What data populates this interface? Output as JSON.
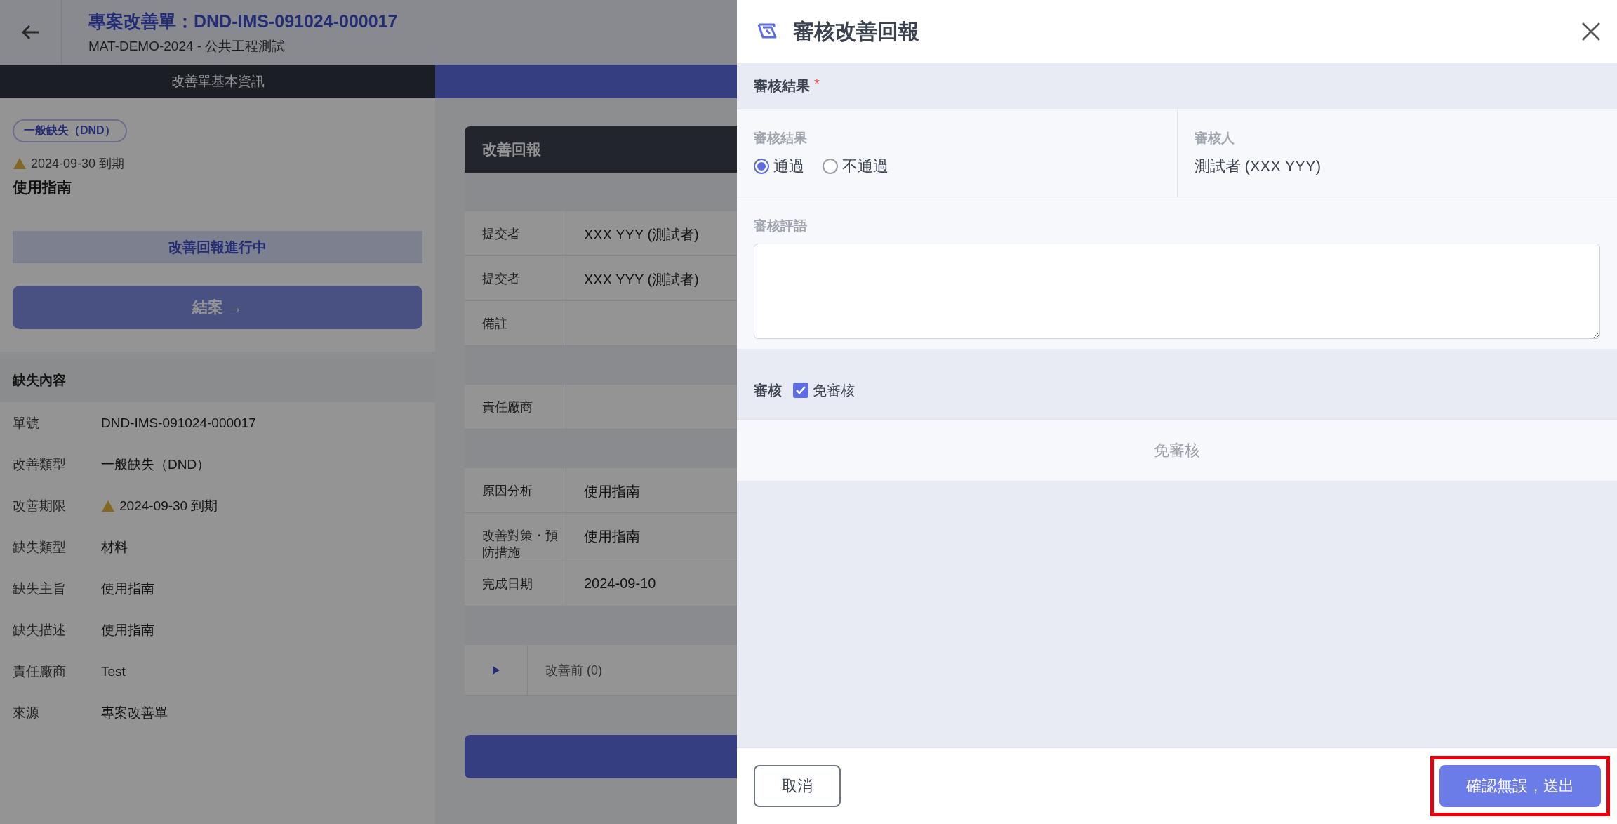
{
  "background": {
    "header": {
      "title": "專案改善單：DND-IMS-091024-000017",
      "subtitle": "MAT-DEMO-2024 - 公共工程測試"
    },
    "tabs": [
      {
        "label": "改善單基本資訊",
        "selected": true
      },
      {
        "selected": false
      }
    ],
    "summary": {
      "chip": "一般缺失（DND）",
      "due": "2024-09-30 到期",
      "subject": "使用指南",
      "status": "改善回報進行中",
      "close_button": "結案 →"
    },
    "defect_section": {
      "title": "缺失內容",
      "rows": [
        {
          "label": "單號",
          "value": "DND-IMS-091024-000017",
          "kind": "text"
        },
        {
          "label": "改善類型",
          "value": "一般缺失（DND）",
          "kind": "text"
        },
        {
          "label": "改善期限",
          "value": "2024-09-30 到期",
          "kind": "warning"
        },
        {
          "label": "缺失類型",
          "value": "材料",
          "kind": "text"
        },
        {
          "label": "缺失主旨",
          "value": "使用指南",
          "kind": "text"
        },
        {
          "label": "缺失描述",
          "value": "使用指南",
          "kind": "text"
        },
        {
          "label": "責任廠商",
          "value": "Test",
          "kind": "text"
        },
        {
          "label": "來源",
          "value": "專案改善單",
          "kind": "text"
        }
      ]
    },
    "report_card": {
      "title": "改善回報",
      "groups": [
        [
          {
            "label": "提交者",
            "value": "XXX YYY (測試者)"
          },
          {
            "label": "提交者",
            "value": "XXX YYY (測試者)"
          },
          {
            "label": "備註"
          }
        ],
        [
          {
            "label": "責任廠商"
          }
        ],
        [
          {
            "label": "原因分析",
            "value": "使用指南"
          },
          {
            "label": "改善對策・預防措施",
            "value": "使用指南"
          },
          {
            "label": "完成日期",
            "value": "2024-09-10"
          }
        ]
      ],
      "photo_rows": [
        {
          "label": "改善前 (0)",
          "expanded": false
        }
      ]
    }
  },
  "drawer": {
    "title": "審核改善回報",
    "result_section": {
      "title": "審核結果",
      "required_mark": "*",
      "result_label": "審核結果",
      "options": [
        {
          "label": "通過",
          "selected": true
        },
        {
          "label": "不通過",
          "selected": false
        }
      ],
      "reviewer_label": "審核人",
      "reviewer": "測試者 (XXX YYY)",
      "comment_label": "審核評語"
    },
    "review_section": {
      "title": "審核",
      "option": {
        "label": "免審核",
        "checked": true
      },
      "note": "免審核"
    },
    "buttons": [
      {
        "label": "取消",
        "kind": "secondary"
      },
      {
        "label": "確認無誤，送出",
        "kind": "primary",
        "highlighted": true
      }
    ]
  }
}
